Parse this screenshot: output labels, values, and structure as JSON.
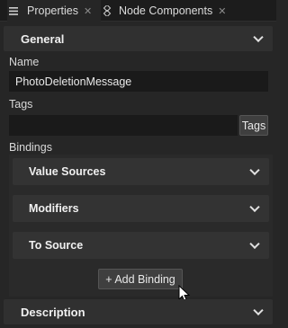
{
  "tabs": [
    {
      "label": "Properties",
      "icon": "hamburger-icon",
      "close": "✕"
    },
    {
      "label": "Node Components",
      "icon": "nodes-icon",
      "close": "✕"
    }
  ],
  "general": {
    "title": "General",
    "name_label": "Name",
    "name_value": "PhotoDeletionMessage",
    "tags_label": "Tags",
    "tags_value": "",
    "tags_button": "Tags",
    "bindings_label": "Bindings",
    "value_sources": "Value Sources",
    "modifiers": "Modifiers",
    "to_source": "To Source",
    "add_binding": "+ Add Binding"
  },
  "description": {
    "title": "Description"
  },
  "colors": {
    "background": "#262626",
    "header": "#303030",
    "field": "#1a1a1a"
  }
}
